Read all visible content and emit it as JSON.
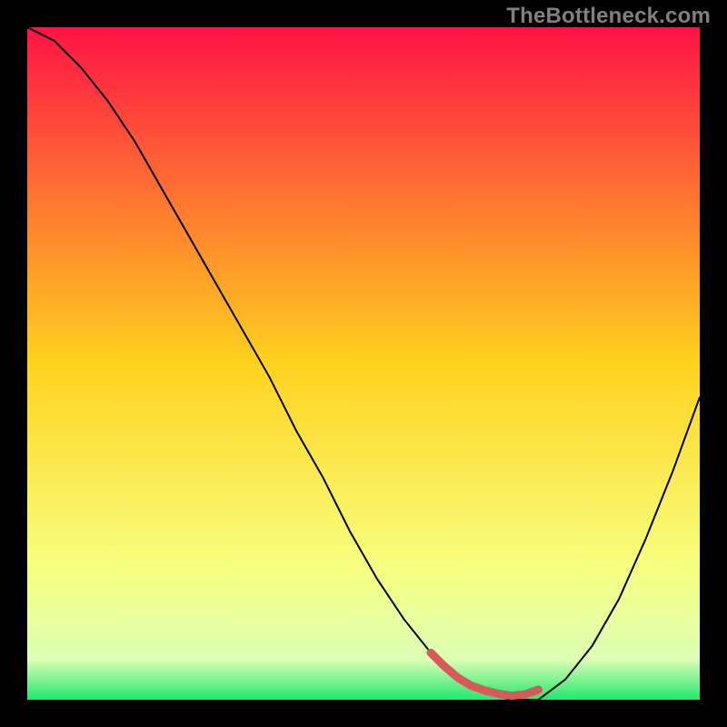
{
  "watermark": "TheBottleneck.com",
  "chart_data": {
    "type": "line",
    "title": "",
    "xlabel": "",
    "ylabel": "",
    "xlim": [
      0,
      100
    ],
    "ylim": [
      0,
      100
    ],
    "background_gradient": {
      "type": "vertical",
      "stops": [
        {
          "pos": 0.0,
          "color": "#ff1345"
        },
        {
          "pos": 0.5,
          "color": "#ffd21e"
        },
        {
          "pos": 0.8,
          "color": "#f7ff7f"
        },
        {
          "pos": 0.94,
          "color": "#dcffb4"
        },
        {
          "pos": 1.0,
          "color": "#21e86f"
        }
      ]
    },
    "series": [
      {
        "name": "bottleneck-curve",
        "color": "#000000",
        "width": 2,
        "x": [
          0,
          4,
          8,
          12,
          16,
          20,
          24,
          28,
          32,
          36,
          40,
          44,
          48,
          52,
          56,
          60,
          64,
          68,
          72,
          76,
          80,
          84,
          88,
          92,
          96,
          100
        ],
        "y": [
          100,
          98,
          94,
          89,
          83,
          76,
          69,
          62,
          55,
          48,
          40,
          33,
          25,
          18,
          12,
          7,
          3,
          1,
          0,
          0,
          3,
          8,
          15,
          24,
          34,
          45
        ]
      }
    ],
    "highlight": {
      "name": "optimal-zone",
      "color": "#d65a5a",
      "width": 9,
      "x": [
        60,
        62,
        64,
        66,
        68,
        70,
        72,
        74,
        76
      ],
      "y": [
        7,
        5,
        3.3,
        2.1,
        1.4,
        0.9,
        0.6,
        0.8,
        1.5
      ]
    }
  }
}
